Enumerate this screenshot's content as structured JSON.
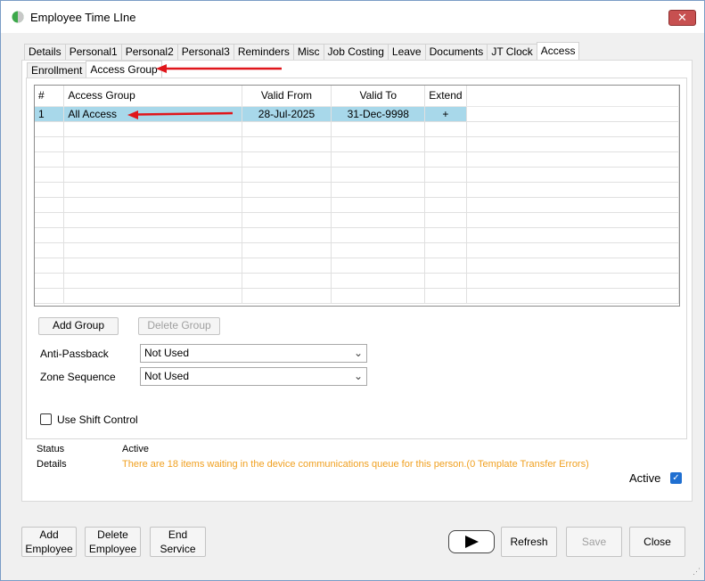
{
  "window": {
    "title": "Employee Time LIne",
    "close_glyph": "✕"
  },
  "tabs": [
    "Details",
    "Personal1",
    "Personal2",
    "Personal3",
    "Reminders",
    "Misc",
    "Job Costing",
    "Leave",
    "Documents",
    "JT Clock",
    "Access"
  ],
  "subtabs": [
    "Enrollment",
    "Access Group"
  ],
  "grid": {
    "headers": [
      "#",
      "Access Group",
      "Valid From",
      "Valid To",
      "Extend"
    ],
    "rows": [
      {
        "num": "1",
        "group": "All Access",
        "from": "28-Jul-2025",
        "to": "31-Dec-9998",
        "extend": "+"
      }
    ]
  },
  "buttons": {
    "add_group": "Add Group",
    "delete_group": "Delete Group",
    "add_employee": "Add\nEmployee",
    "delete_employee": "Delete\nEmployee",
    "end_service": "End\nService",
    "refresh": "Refresh",
    "save": "Save",
    "close": "Close"
  },
  "fields": {
    "anti_passback_label": "Anti-Passback",
    "anti_passback_value": "Not Used",
    "zone_sequence_label": "Zone Sequence",
    "zone_sequence_value": "Not Used",
    "shift_control_label": "Use Shift Control"
  },
  "status": {
    "status_label": "Status",
    "status_value": "Active",
    "details_label": "Details",
    "details_value": "There are 18 items waiting in the device communications queue for this person.(0 Template Transfer Errors)",
    "active_label": "Active"
  },
  "colors": {
    "annotation_arrow": "#e0161b",
    "selected_row": "#a8d8ea",
    "details_text": "#f0a020"
  }
}
